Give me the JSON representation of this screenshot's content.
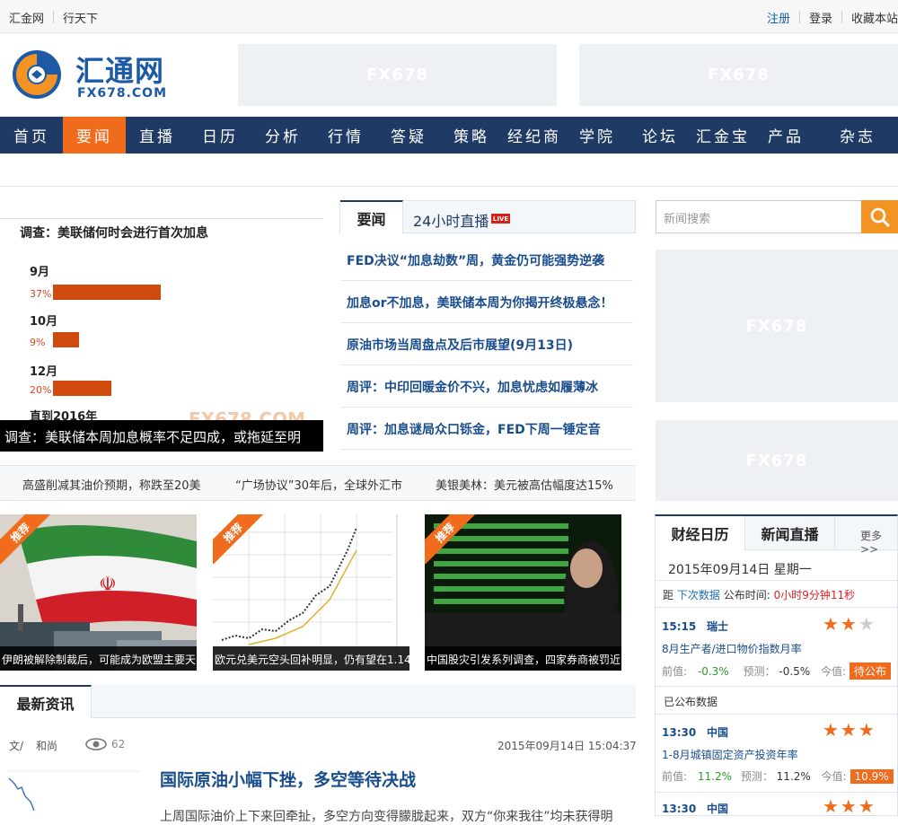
{
  "topbar": {
    "left_links": [
      "汇金网",
      "行天下"
    ],
    "right_links": [
      "注册",
      "登录",
      "收藏本站"
    ]
  },
  "logo": {
    "name": "汇通网",
    "domain": "FX678.COM"
  },
  "ad_label": "FX678",
  "nav": [
    "首页",
    "要闻",
    "直播",
    "日历",
    "分析",
    "行情",
    "答疑",
    "策略",
    "经纪商",
    "学院",
    "论坛",
    "汇金宝",
    "产品",
    "杂志"
  ],
  "nav_active": 1,
  "survey": {
    "title": "调查：美联储何时会进行首次加息",
    "items": [
      {
        "label": "9月",
        "pct": "37%",
        "value": 37
      },
      {
        "label": "10月",
        "pct": "9%",
        "value": 9
      },
      {
        "label": "12月",
        "pct": "20%",
        "value": 20
      },
      {
        "label": "直到2016年",
        "pct": "",
        "value": null
      }
    ],
    "caption": "调查：美联储本周加息概率不足四成，或拖延至明",
    "watermark": "FX678.COM"
  },
  "news_tabs": {
    "tab1": "要闻",
    "tab2": "24小时直播",
    "live_badge": "LIVE"
  },
  "news": [
    "FED决议“加息劫数”周，黄金仍可能强势逆袭",
    "加息or不加息，美联储本周为你揭开终极悬念！",
    "原油市场当周盘点及后市展望(9月13日)",
    "周评：中印回暖金价不兴，加息忧虑如履薄冰",
    "周评：加息谜局众口铄金，FED下周一锤定音"
  ],
  "ticker": [
    "高盛削减其油价预期，称跌至20美",
    "“广场协议”30年后，全球外汇市",
    "美银美林：美元被高估幅度达15%"
  ],
  "photos": [
    {
      "tag": "推荐",
      "caption": "伊朗被解除制裁后，可能成为欧盟主要天"
    },
    {
      "tag": "推荐",
      "caption": "欧元兑美元空头回补明显，仍有望在1.14"
    },
    {
      "tag": "推荐",
      "caption": "中国股灾引发系列调查，四家券商被罚近"
    }
  ],
  "latest": {
    "tab": "最新资讯",
    "author_label": "文/",
    "author": "和尚",
    "views": "62",
    "datetime": "2015年09月14日 15:04:37",
    "title": "国际原油小幅下挫，多空等待决战",
    "summary": "上周国际油价上下来回牵扯，多空方向变得朦胧起来，双方“你来我往”均未获得明"
  },
  "search": {
    "placeholder": "新闻搜索"
  },
  "calendar": {
    "tab1": "财经日历",
    "tab2": "新闻直播",
    "more": "更多>>",
    "date": "2015年09月14日  星期一",
    "next_prefix": "距",
    "next_link": "下次数据",
    "next_label": "公布时间:",
    "next_countdown": "0小时9分钟11秒",
    "published_label": "已公布数据",
    "events": [
      {
        "time": "15:15",
        "country": "瑞士",
        "stars": 2,
        "name": "8月生产者/进口物价指数月率",
        "prev_label": "前值:",
        "prev": "-0.3%",
        "fc_label": "预测：",
        "forecast": "-0.5%",
        "act_label": "今值:",
        "actual": "待公布"
      },
      {
        "time": "13:30",
        "country": "中国",
        "stars": 3,
        "name": "1-8月城镇固定资产投资年率",
        "prev_label": "前值:",
        "prev": "11.2%",
        "fc_label": "预测：",
        "forecast": "11.2%",
        "act_label": "今值:",
        "actual": "10.9%"
      },
      {
        "time": "13:30",
        "country": "中国",
        "stars": 3,
        "name": "",
        "prev_label": "",
        "prev": "",
        "fc_label": "",
        "forecast": "",
        "act_label": "",
        "actual": ""
      }
    ]
  }
}
